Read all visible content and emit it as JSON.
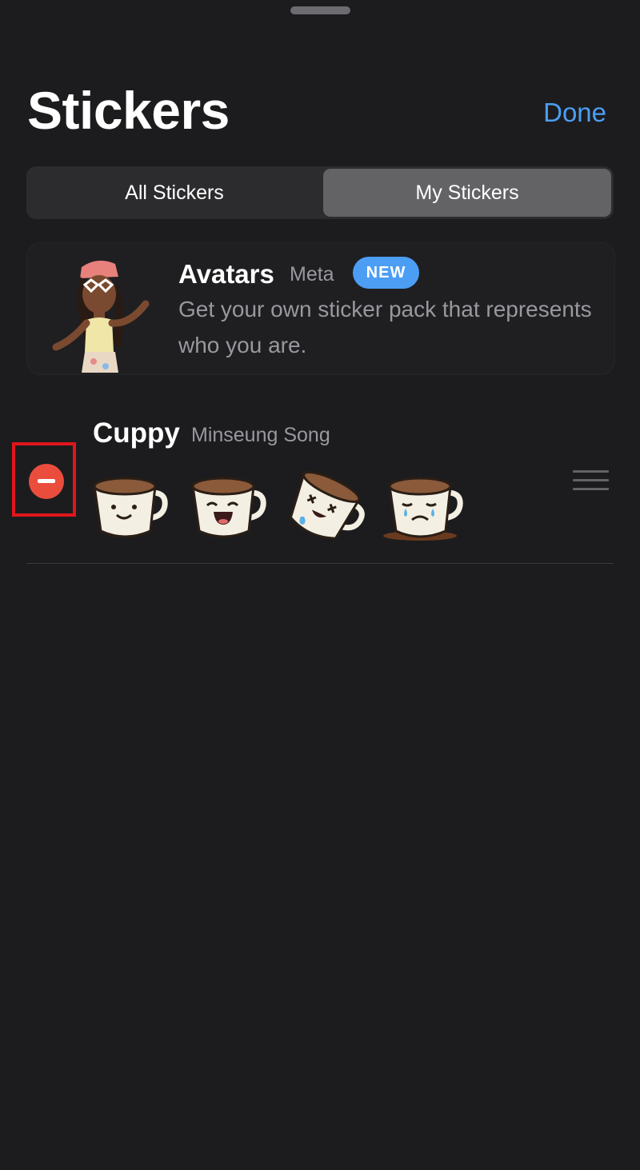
{
  "header": {
    "title": "Stickers",
    "done_label": "Done"
  },
  "tabs": [
    {
      "label": "All Stickers",
      "selected": false
    },
    {
      "label": "My Stickers",
      "selected": true
    }
  ],
  "promo": {
    "name": "Avatars",
    "publisher": "Meta",
    "badge": "NEW",
    "description": "Get your own sticker pack that represents who you are."
  },
  "pack": {
    "name": "Cuppy",
    "author": "Minseung Song",
    "stickers": [
      "smiling-cup-sticker",
      "laughing-cup-sticker",
      "dizzy-cup-sticker",
      "crying-cup-sticker"
    ]
  },
  "colors": {
    "accent": "#4c9ef5",
    "delete": "#eb4d3d",
    "highlight": "#e0161b",
    "background": "#1c1c1e"
  }
}
